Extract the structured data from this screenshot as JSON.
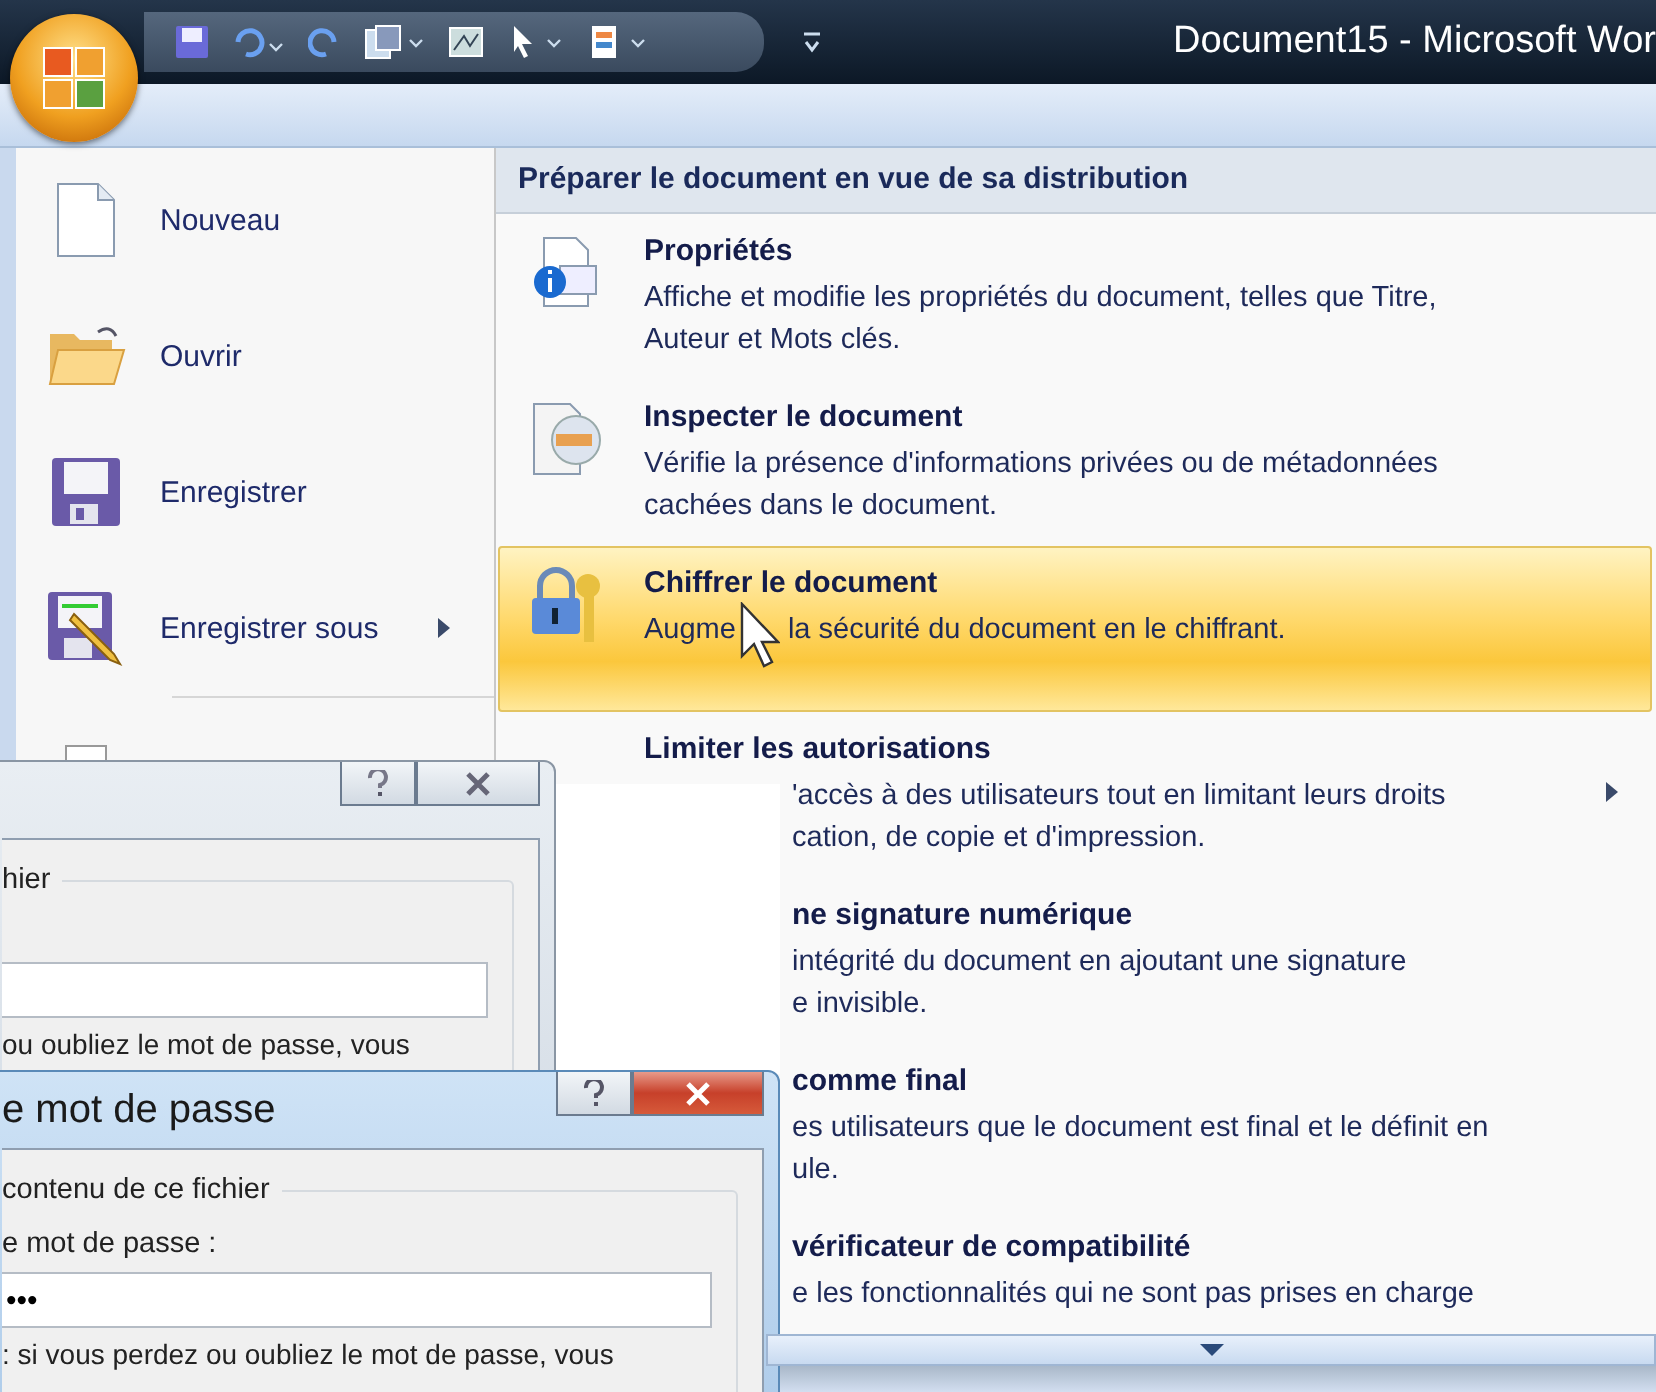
{
  "window": {
    "title": "Document15 - Microsoft Wor"
  },
  "file_menu": {
    "items": [
      {
        "kind": "new",
        "label": "Nouveau",
        "submenu": false
      },
      {
        "kind": "open",
        "label": "Ouvrir",
        "submenu": false
      },
      {
        "kind": "save",
        "label": "Enregistrer",
        "submenu": false
      },
      {
        "kind": "save_as",
        "label": "Enregistrer sous",
        "submenu": true
      },
      {
        "kind": "print",
        "submenu": false
      }
    ]
  },
  "prepare_panel": {
    "heading": "Préparer le document en vue de sa distribution",
    "items": [
      {
        "kind": "properties",
        "title": "Propriétés",
        "lines": [
          "Affiche et modifie les propriétés du document, telles que Titre,",
          "Auteur et Mots clés."
        ],
        "selected": false,
        "submenu": false
      },
      {
        "kind": "inspect",
        "title": "Inspecter le document",
        "lines": [
          "Vérifie la présence d'informations privées ou de métadonnées",
          "cachées dans le document."
        ],
        "selected": false,
        "submenu": false
      },
      {
        "kind": "encrypt",
        "title": "Chiffrer le document",
        "lines": [
          "Augme",
          "la sécurité du document en le chiffrant."
        ],
        "selected": true,
        "submenu": false
      },
      {
        "kind": "lines_covered",
        "title": "Limiter les autorisations",
        "lines": [
          "'accès à des utilisateurs tout en limitant leurs droits",
          "cation, de copie et d'impression."
        ],
        "selected": false,
        "submenu": true
      },
      {
        "kind": "covered",
        "title": "ne signature numérique",
        "lines": [
          "intégrité du document en ajoutant une signature",
          "e invisible."
        ],
        "selected": false,
        "submenu": false
      },
      {
        "kind": "covered",
        "title": "comme final",
        "lines": [
          "es utilisateurs que le document est final et le définit en",
          "ule."
        ],
        "selected": false,
        "submenu": false
      },
      {
        "kind": "covered",
        "title": "vérificateur de compatibilité",
        "lines": [
          "e les fonctionnalités qui ne sont pas prises en charge"
        ],
        "selected": false,
        "submenu": false
      }
    ]
  },
  "dialogs": [
    {
      "group_label": "hier",
      "note": "ou oubliez le mot de passe, vous",
      "active": false
    },
    {
      "title": "e mot de passe",
      "group_label": "contenu de ce fichier",
      "field_label": "e mot de passe :",
      "password_value": "•••",
      "note": ": si vous perdez ou oubliez le mot de passe, vous",
      "active": true
    }
  ]
}
